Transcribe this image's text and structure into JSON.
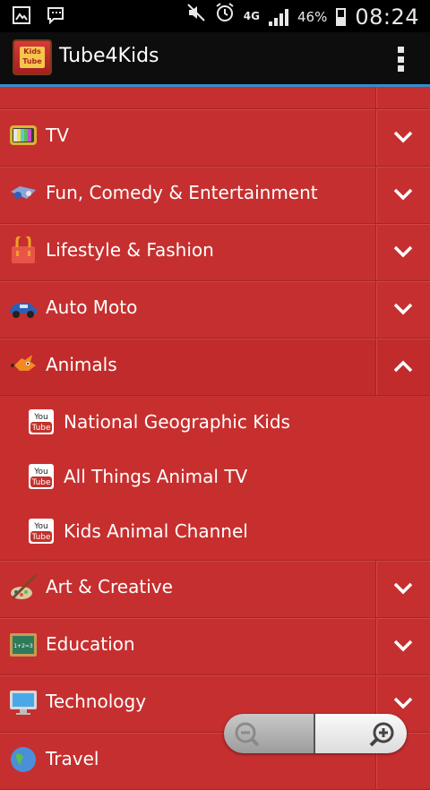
{
  "status_bar": {
    "network": "4G",
    "battery_percent": "46%",
    "time": "08:24",
    "icons": [
      "image-icon",
      "message-icon",
      "mute-icon",
      "alarm-icon",
      "signal-icon",
      "battery-icon"
    ]
  },
  "app_bar": {
    "title": "Tube4Kids",
    "logo_text_line1": "Kids",
    "logo_text_line2": "Tube",
    "menu_icon": "overflow-menu-icon"
  },
  "categories": [
    {
      "label": "TV",
      "icon": "tv-icon",
      "expanded": false
    },
    {
      "label": "Fun, Comedy & Entertainment",
      "icon": "fun-icon",
      "expanded": false
    },
    {
      "label": "Lifestyle & Fashion",
      "icon": "bag-icon",
      "expanded": false
    },
    {
      "label": "Auto Moto",
      "icon": "car-icon",
      "expanded": false
    },
    {
      "label": "Animals",
      "icon": "fox-icon",
      "expanded": true
    },
    {
      "label": "Art & Creative",
      "icon": "brush-icon",
      "expanded": false
    },
    {
      "label": "Education",
      "icon": "chalkboard-icon",
      "expanded": false
    },
    {
      "label": "Technology",
      "icon": "monitor-icon",
      "expanded": false
    },
    {
      "label": "Travel",
      "icon": "globe-icon",
      "expanded": false
    }
  ],
  "animals_channels": [
    {
      "label": "National Geographic Kids",
      "icon": "youtube-icon"
    },
    {
      "label": "All Things Animal TV",
      "icon": "youtube-icon"
    },
    {
      "label": "Kids Animal Channel",
      "icon": "youtube-icon"
    }
  ],
  "youtube_badge": {
    "top": "You",
    "bottom": "Tube"
  },
  "education_board_text": "1+2=3",
  "zoom": {
    "out_icon": "zoom-out-icon",
    "in_icon": "zoom-in-icon"
  }
}
